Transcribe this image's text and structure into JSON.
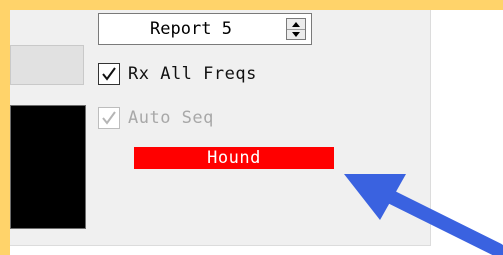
{
  "report_spinner": {
    "value": "Report 5"
  },
  "checkboxes": {
    "rx_all_freqs": {
      "label": "Rx All Freqs",
      "checked": true,
      "enabled": true
    },
    "auto_seq": {
      "label": "Auto Seq",
      "checked": true,
      "enabled": false
    }
  },
  "hound_indicator": {
    "label": "Hound",
    "color": "#ff0000"
  },
  "annotation_arrow": {
    "color": "#3a62e0"
  },
  "frame": {
    "color": "#ffd36a"
  }
}
